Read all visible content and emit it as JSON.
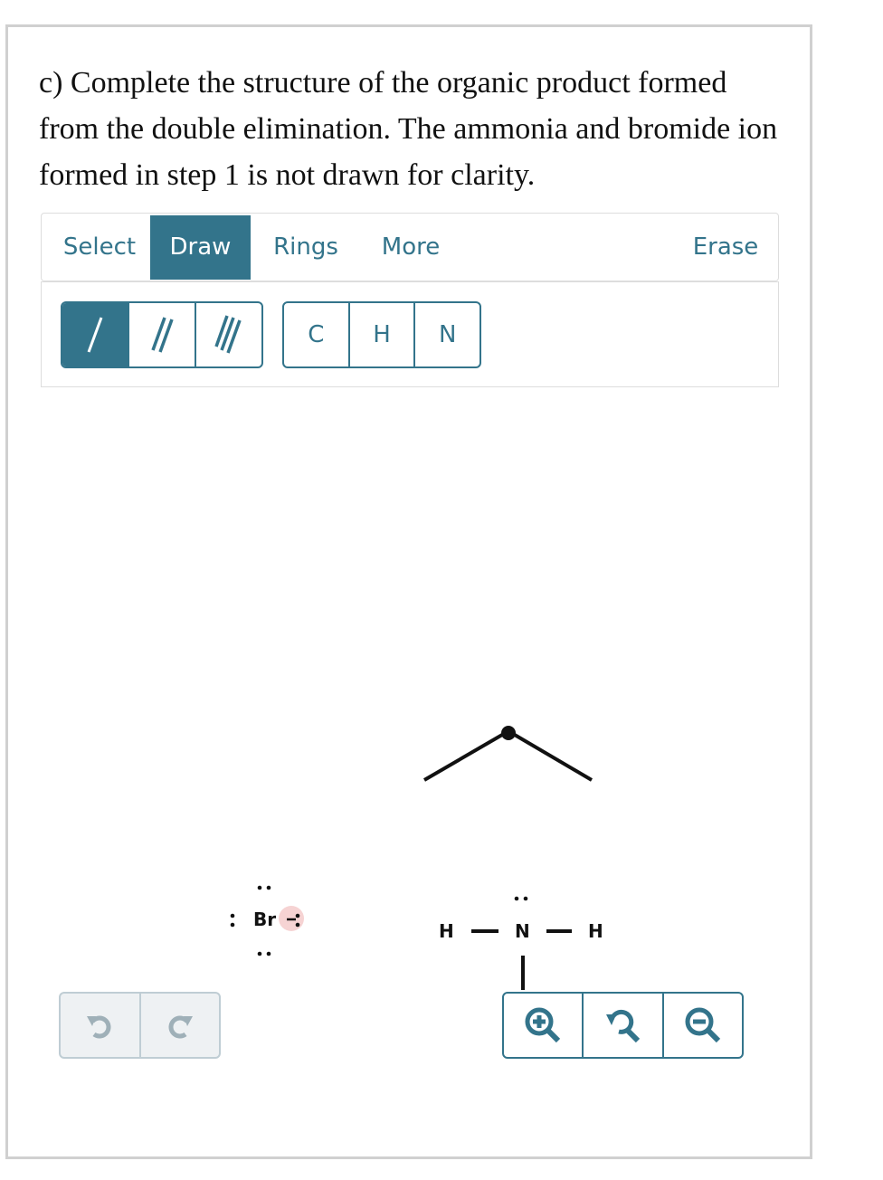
{
  "question": "c) Complete the structure of the organic product formed from the double elimination. The ammonia and bromide ion formed in step 1 is not drawn for clarity.",
  "tabs": {
    "select": "Select",
    "draw": "Draw",
    "rings": "Rings",
    "more": "More",
    "erase": "Erase"
  },
  "atoms": {
    "c": "C",
    "h": "H",
    "n": "N"
  },
  "canvas": {
    "bromide": "Br",
    "ammonia_n": "N",
    "ammonia_h1": "H",
    "ammonia_h2": "H"
  },
  "colors": {
    "accent": "#33748b",
    "charge": "#f6d3d3"
  }
}
